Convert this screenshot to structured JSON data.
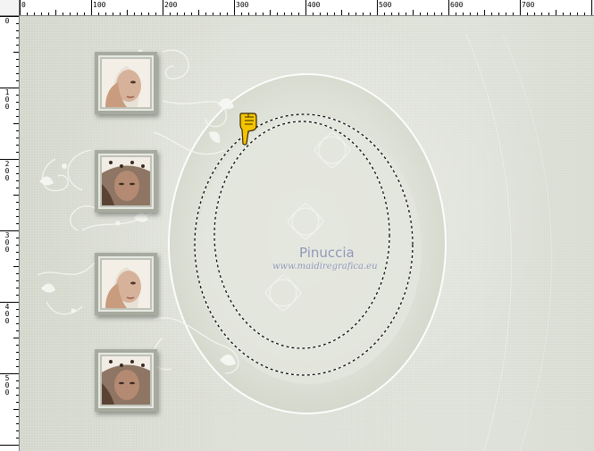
{
  "ruler": {
    "top_labels": [
      "0",
      "100",
      "200",
      "300",
      "400",
      "500",
      "600",
      "700"
    ],
    "left_labels": [
      "0",
      "100",
      "200",
      "300",
      "400",
      "500"
    ]
  },
  "canvas": {
    "watermark_name": "Pinuccia",
    "watermark_url": "www.maidiregrafica.eu"
  },
  "photos": [
    {
      "name": "photo-woman-hand-over-eye"
    },
    {
      "name": "photo-woman-polka-dot-cap"
    },
    {
      "name": "photo-woman-hand-over-eye"
    },
    {
      "name": "photo-woman-polka-dot-cap"
    }
  ],
  "cursor": {
    "icon": "pointing-hand-icon",
    "color": "#f5c400"
  },
  "colors": {
    "canvas_bg": "#dcdfd5",
    "selection": "#000000",
    "ruler_bg": "#ffffff"
  }
}
